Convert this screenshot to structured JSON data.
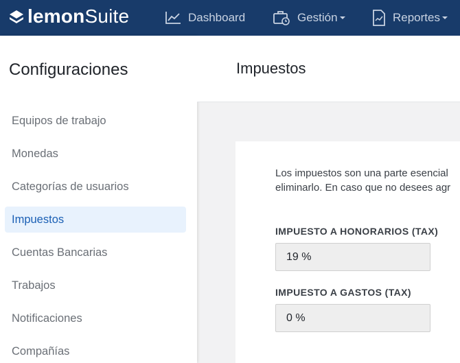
{
  "app": {
    "logo_bold": "lemon",
    "logo_light": "Suite"
  },
  "nav": {
    "dashboard": {
      "label": "Dashboard",
      "icon": "chart-line-icon"
    },
    "gestion": {
      "label": "Gestión",
      "icon": "briefcase-clock-icon"
    },
    "reportes": {
      "label": "Reportes",
      "icon": "report-document-icon"
    }
  },
  "sidebar": {
    "title": "Configuraciones",
    "items": [
      {
        "label": "Equipos de trabajo"
      },
      {
        "label": "Monedas"
      },
      {
        "label": "Categorías de usuarios"
      },
      {
        "label": "Impuestos",
        "active": true
      },
      {
        "label": "Cuentas Bancarias"
      },
      {
        "label": "Trabajos"
      },
      {
        "label": "Notificaciones"
      },
      {
        "label": "Compañías"
      }
    ]
  },
  "page": {
    "title": "Impuestos",
    "description_line1": "Los impuestos son una parte esencial",
    "description_line2": "eliminarlo. En caso que no desees agr",
    "fields": {
      "honorarios": {
        "label": "IMPUESTO A HONORARIOS (TAX)",
        "value": "19 %"
      },
      "gastos": {
        "label": "IMPUESTO A GASTOS (TAX)",
        "value": "0 %"
      }
    }
  },
  "colors": {
    "topbar": "#183b6a",
    "active_bg": "#e8f2fd",
    "active_text": "#1a5fb4"
  }
}
